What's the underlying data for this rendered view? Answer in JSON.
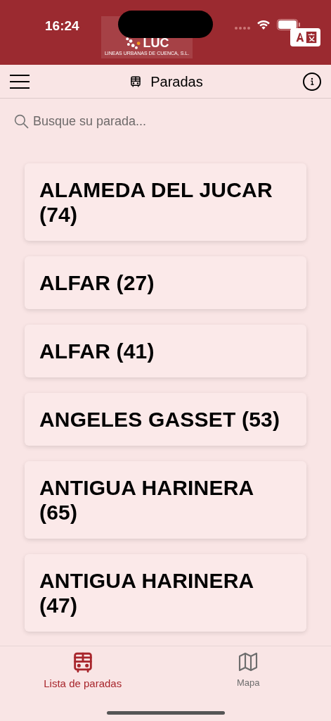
{
  "status_bar": {
    "time": "16:24"
  },
  "logo": {
    "mark": "LUC",
    "subtitle": "LINEAS URBANAS DE CUENCA, S.L."
  },
  "header": {
    "title": "Paradas"
  },
  "search": {
    "placeholder": "Busque su parada..."
  },
  "stops": [
    {
      "name": "ALAMEDA DEL JUCAR (74)"
    },
    {
      "name": "ALFAR (27)"
    },
    {
      "name": "ALFAR (41)"
    },
    {
      "name": "ANGELES GASSET (53)"
    },
    {
      "name": "ANTIGUA HARINERA (65)"
    },
    {
      "name": "ANTIGUA HARINERA (47)"
    }
  ],
  "tabs": [
    {
      "label": "Lista de paradas",
      "kind": "list",
      "selected": true
    },
    {
      "label": "Mapa",
      "kind": "map",
      "selected": false
    }
  ]
}
